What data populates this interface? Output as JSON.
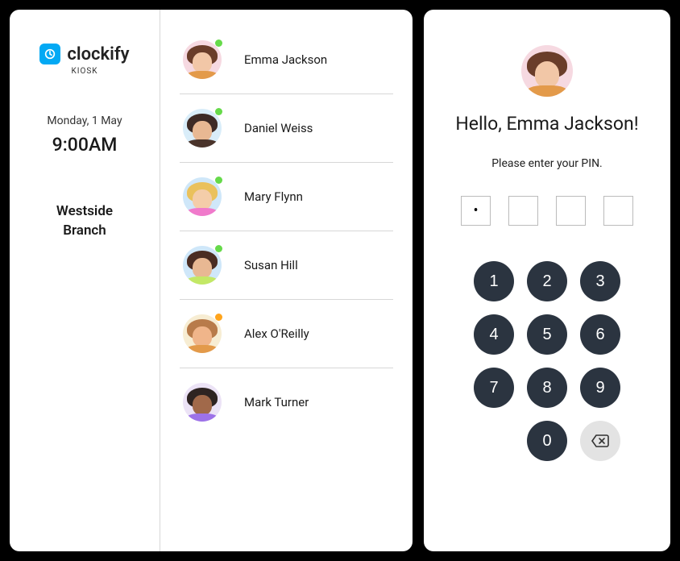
{
  "brand": {
    "name": "clockify",
    "sub": "KIOSK"
  },
  "datetime": {
    "date": "Monday, 1 May",
    "time": "9:00AM"
  },
  "branch": "Westside\nBranch",
  "colors": {
    "status_green": "#66da4a",
    "status_orange": "#ffa41c",
    "logo": "#03a9f4",
    "key_dark": "#2b3440"
  },
  "users": [
    {
      "name": "Emma Jackson",
      "status": "green",
      "avatar_bg": "#f6d9e1",
      "hair": "#6a3d2a",
      "skin": "#f2c7a7",
      "body": "#e39a4a"
    },
    {
      "name": "Daniel Weiss",
      "status": "green",
      "avatar_bg": "#d9edf9",
      "hair": "#3d2a25",
      "skin": "#e8b893",
      "body": "#4a342b"
    },
    {
      "name": "Mary Flynn",
      "status": "green",
      "avatar_bg": "#cfe7f9",
      "hair": "#eac15c",
      "skin": "#f4cda9",
      "body": "#f07acb"
    },
    {
      "name": "Susan Hill",
      "status": "green",
      "avatar_bg": "#cfe7f9",
      "hair": "#4a2c22",
      "skin": "#e8b893",
      "body": "#c3e866"
    },
    {
      "name": "Alex O'Reilly",
      "status": "orange",
      "avatar_bg": "#f7edd3",
      "hair": "#b87b4a",
      "skin": "#f0b58a",
      "body": "#e39a4a"
    },
    {
      "name": "Mark Turner",
      "status": "",
      "avatar_bg": "#ece3f6",
      "hair": "#2e2422",
      "skin": "#a1694a",
      "body": "#9d72e8"
    }
  ],
  "selected_user": {
    "name": "Emma Jackson",
    "avatar_bg": "#f6d9e1",
    "hair": "#6a3d2a",
    "skin": "#f2c7a7",
    "body": "#e39a4a"
  },
  "greeting_prefix": "Hello, ",
  "greeting_suffix": "!",
  "pin_instruction": "Please enter your PIN.",
  "pin_entry": [
    "•",
    "",
    "",
    ""
  ],
  "keypad": {
    "1": "1",
    "2": "2",
    "3": "3",
    "4": "4",
    "5": "5",
    "6": "6",
    "7": "7",
    "8": "8",
    "9": "9",
    "0": "0"
  }
}
